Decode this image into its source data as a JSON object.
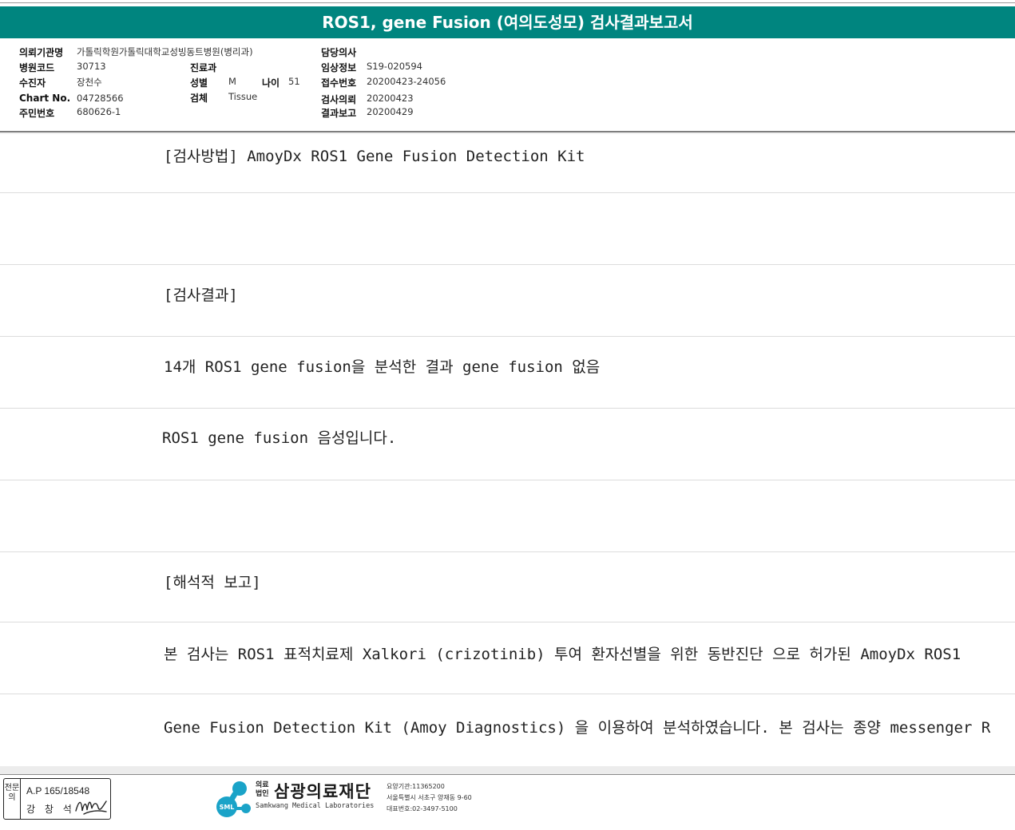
{
  "report": {
    "title": "ROS1, gene Fusion (여의도성모) 검사결과보고서"
  },
  "info": {
    "institution": {
      "label": "의뢰기관명",
      "value": "가톨릭학원가톨릭대학교성빙동트병원(병리과)"
    },
    "hospital_code": {
      "label": "병원코드",
      "value": "30713"
    },
    "recipient": {
      "label": "수진자",
      "value": "장천수"
    },
    "chart_no": {
      "label": "Chart No.",
      "value": "04728566"
    },
    "resident_no": {
      "label": "주민번호",
      "value": "680626-1"
    },
    "department": {
      "label": "진료과",
      "value": ""
    },
    "sex": {
      "label": "성별",
      "value": "M"
    },
    "age": {
      "label": "나이",
      "value": "51"
    },
    "specimen": {
      "label": "검체",
      "value": "Tissue"
    },
    "doctor": {
      "label": "담당의사",
      "value": ""
    },
    "clinical_info": {
      "label": "임상정보",
      "value": "S19-020594"
    },
    "receipt_no": {
      "label": "접수번호",
      "value": "20200423-24056"
    },
    "request_date": {
      "label": "검사의뢰",
      "value": "20200423"
    },
    "report_date": {
      "label": "결과보고",
      "value": "20200429"
    }
  },
  "content": {
    "rows": [
      "[검사방법] AmoyDx ROS1 Gene Fusion Detection Kit",
      "",
      "[검사결과]",
      "14개 ROS1 gene fusion을 분석한 결과 gene fusion 없음",
      "ROS1 gene fusion 음성입니다.",
      "",
      "[해석적 보고]",
      "본 검사는 ROS1 표적치료제 Xalkori (crizotinib) 투여 환자선별을 위한 동반진단 으로 허가된 AmoyDx ROS1",
      " Gene Fusion Detection Kit (Amoy Diagnostics) 을 이용하여 분석하였습니다. 본 검사는 종양 messenger R"
    ]
  },
  "footer": {
    "stamp": {
      "side_label": "전문의",
      "license": "A.P 165/18548",
      "name": "강 창 석"
    },
    "logo": {
      "corp_type": "의료 법인",
      "name": "삼광의료재단",
      "english": "Samkwang Medical Laboratories",
      "badge": "SML",
      "care_no": "요양기관:11365200",
      "address": "서울특별시 서초구 양재동 9-60",
      "phone": "대표번호:02-3497-5100"
    }
  },
  "colors": {
    "title_bar": "#00857f",
    "logo": "#1aa3c8"
  }
}
